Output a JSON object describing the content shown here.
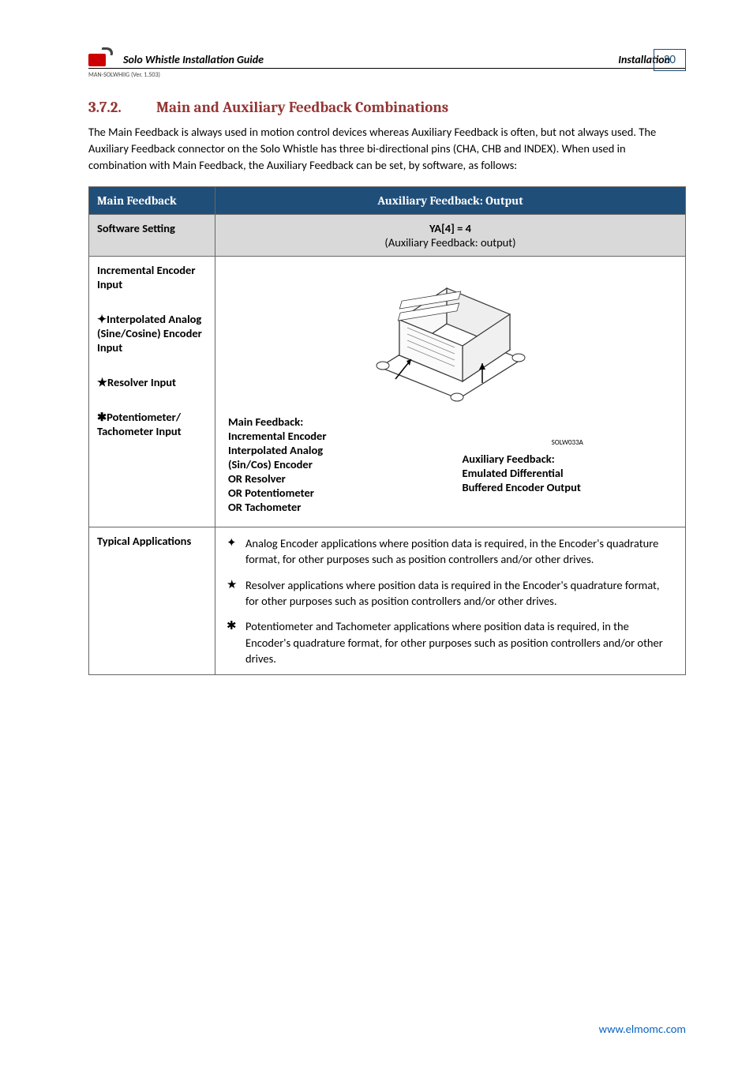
{
  "header": {
    "doc_title": "Solo Whistle Installation Guide",
    "section_label": "Installation",
    "page_number": "30",
    "version": "MAN-SOLWHIIG (Ver. 1.503)"
  },
  "heading": {
    "number": "3.7.2.",
    "title": "Main and Auxiliary Feedback Combinations"
  },
  "intro": "The Main Feedback is always used in motion control devices whereas Auxiliary Feedback is often, but not always used. The Auxiliary Feedback connector on the Solo Whistle has three bi-directional pins (CHA, CHB and INDEX). When used in combination with Main Feedback, the Auxiliary Feedback can be set, by software, as follows:",
  "table": {
    "top_left_header": "Main Feedback",
    "top_right_header": "Auxiliary Feedback: Output",
    "sw_label": "Software Setting",
    "sw_value_main": "YA[4] = 4",
    "sw_value_sub": "(Auxiliary Feedback: output)",
    "left_rows": [
      {
        "prefix": "",
        "text": "Incremental Encoder Input"
      },
      {
        "prefix": "✦",
        "text": "Interpolated Analog (Sine/Cosine) Encoder Input"
      },
      {
        "prefix": "★",
        "text": "Resolver Input"
      },
      {
        "prefix": "✱",
        "text": "Potentiometer/ Tachometer Input"
      }
    ],
    "main_fb_label": "Main Feedback:",
    "main_fb_lines": [
      "Incremental Encoder",
      "Interpolated Analog",
      "(Sin/Cos) Encoder",
      "OR Resolver",
      "OR Potentiometer",
      "OR Tachometer"
    ],
    "device_code": "SOLW033A",
    "aux_fb_label": "Auxiliary Feedback:",
    "aux_fb_lines": [
      "Emulated Differential",
      "Buffered Encoder Output"
    ],
    "apps_label": "Typical Applications",
    "apps": [
      {
        "bullet": "✦",
        "text": "Analog Encoder applications where position data is required, in the Encoder's quadrature format, for other purposes such as position controllers and/or other drives."
      },
      {
        "bullet": "★",
        "text": "Resolver applications where position data is required in the Encoder's quadrature format, for other purposes such as position controllers and/or other drives."
      },
      {
        "bullet": "✱",
        "text": "Potentiometer and Tachometer applications where position data is required, in the Encoder's quadrature format, for other purposes such as position controllers and/or other drives."
      }
    ]
  },
  "footer_link": "www.elmomc.com"
}
